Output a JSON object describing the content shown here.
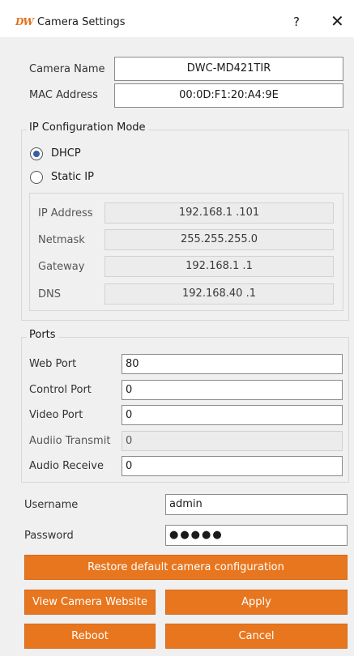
{
  "window": {
    "logo": "DW",
    "title": "Camera Settings",
    "help_label": "?",
    "close_label": "✕"
  },
  "camera": {
    "name_label": "Camera Name",
    "name_value": "DWC-MD421TIR",
    "mac_label": "MAC Address",
    "mac_value": "00:0D:F1:20:A4:9E"
  },
  "ip_config": {
    "group_title": "IP Configuration Mode",
    "dhcp_label": "DHCP",
    "static_label": "Static IP",
    "selected": "DHCP",
    "ip_label": "IP Address",
    "ip_value": "192.168.1  .101",
    "netmask_label": "Netmask",
    "netmask_value": "255.255.255.0",
    "gateway_label": "Gateway",
    "gateway_value": "192.168.1  .1",
    "dns_label": "DNS",
    "dns_value": "192.168.40 .1"
  },
  "ports": {
    "group_title": "Ports",
    "web_label": "Web Port",
    "web_value": "80",
    "control_label": "Control Port",
    "control_value": "0",
    "video_label": "Video Port",
    "video_value": "0",
    "audio_tx_label": "Audiio Transmit",
    "audio_tx_value": "0",
    "audio_rx_label": "Audio Receive",
    "audio_rx_value": "0"
  },
  "auth": {
    "username_label": "Username",
    "username_value": "admin",
    "password_label": "Password",
    "password_value": "●●●●●"
  },
  "buttons": {
    "restore": "Restore default camera configuration",
    "view_site": "View Camera Website",
    "apply": "Apply",
    "reboot": "Reboot",
    "cancel": "Cancel"
  },
  "colors": {
    "accent": "#e8761e",
    "panel_bg": "#f0f0f0"
  }
}
